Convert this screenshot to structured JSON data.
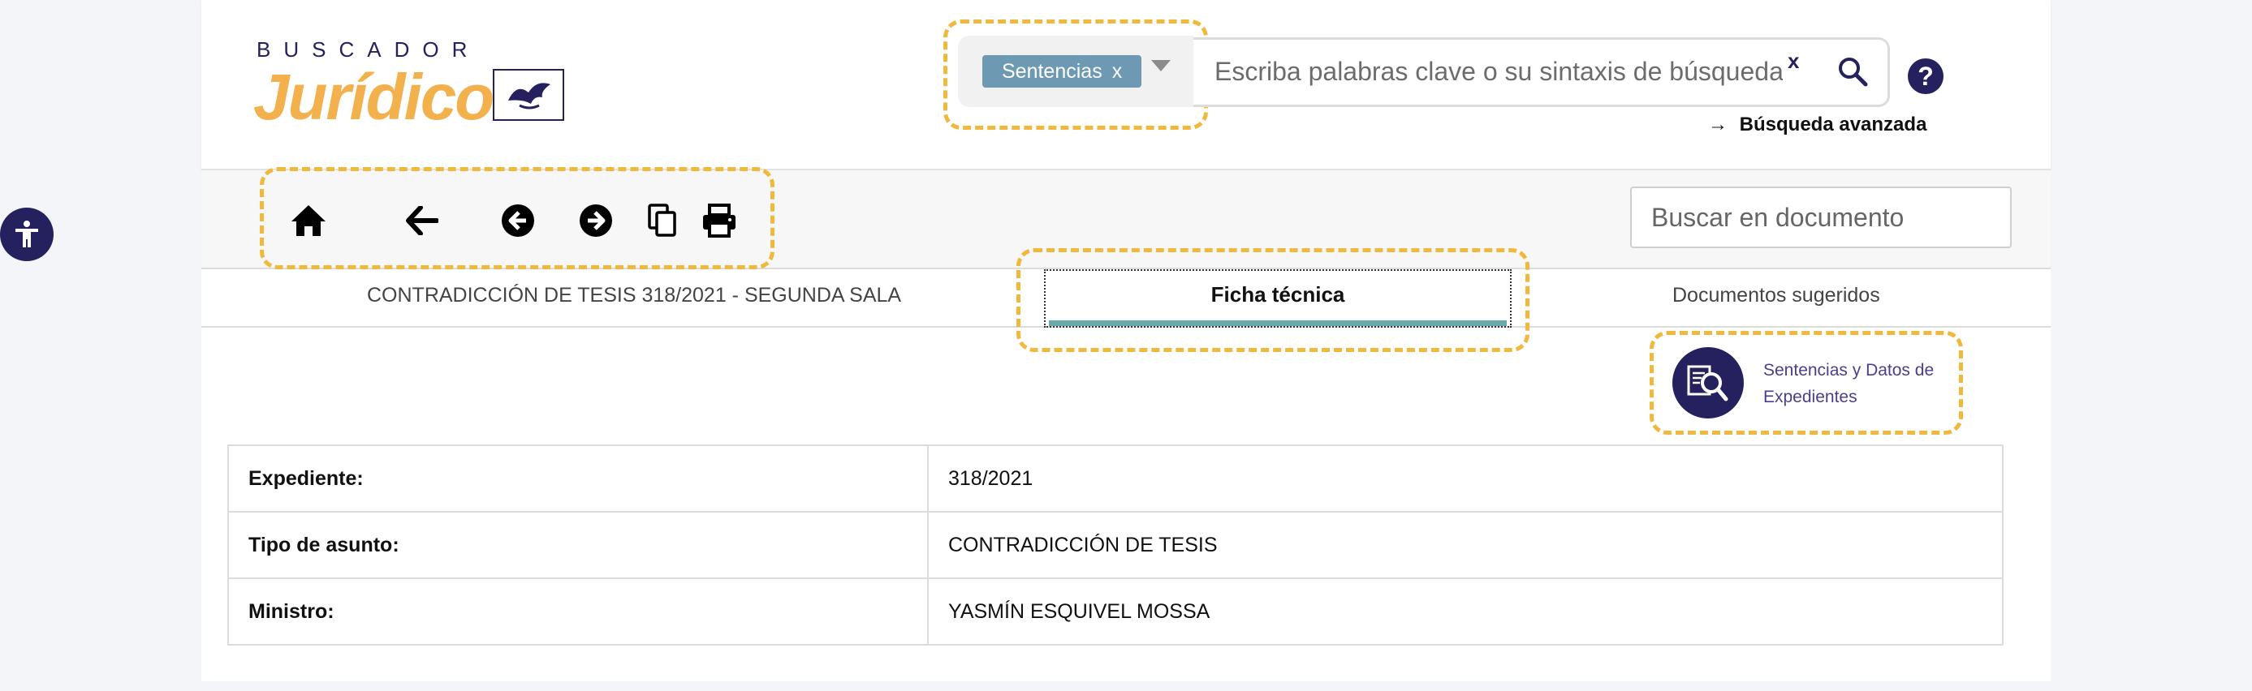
{
  "accessibility": {
    "icon": "accessibility-icon"
  },
  "header": {
    "logo_top": "BUSCADOR",
    "logo_main": "Jurídico",
    "search": {
      "type_chip": "Sentencias",
      "chip_close": "x",
      "placeholder": "Escriba palabras clave o su sintaxis de búsqueda",
      "clear": "x",
      "search_icon": "search-icon"
    },
    "help": "?",
    "advanced_arrow": "→",
    "advanced_label": "Búsqueda avanzada"
  },
  "toolbar": {
    "icons": [
      "home-icon",
      "back-arrow-icon",
      "previous-circle-icon",
      "next-circle-icon",
      "copy-icon",
      "print-icon"
    ],
    "doc_search_placeholder": "Buscar en documento"
  },
  "tabs": {
    "document": "CONTRADICCIÓN DE TESIS 318/2021 - SEGUNDA SALA",
    "active": "Ficha técnica",
    "suggested": "Documentos sugeridos"
  },
  "suggestion": {
    "label": "Sentencias y Datos de Expedientes",
    "icon": "document-search-icon"
  },
  "details": [
    {
      "label": "Expediente:",
      "value": "318/2021"
    },
    {
      "label": "Tipo de asunto:",
      "value": "CONTRADICCIÓN DE TESIS"
    },
    {
      "label": "Ministro:",
      "value": "YASMÍN ESQUIVEL MOSSA"
    }
  ],
  "colors": {
    "brand_dark": "#25215e",
    "brand_gold": "#f2b14d",
    "chip": "#6e99b3",
    "tab_underline": "#6aa9a9",
    "highlight": "#f0b93d"
  }
}
